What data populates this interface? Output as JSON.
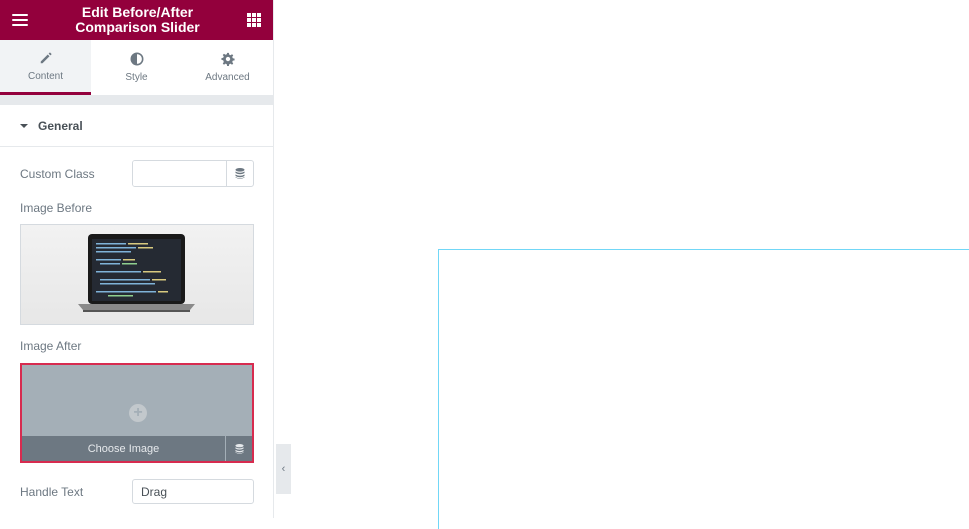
{
  "header": {
    "title_line1": "Edit Before/After",
    "title_line2": "Comparison Slider",
    "menu_icon": "hamburger-icon",
    "apps_icon": "grid-icon"
  },
  "tabs": [
    {
      "label": "Content",
      "icon": "pencil-icon",
      "active": true
    },
    {
      "label": "Style",
      "icon": "half-circle-icon",
      "active": false
    },
    {
      "label": "Advanced",
      "icon": "gear-icon",
      "active": false
    }
  ],
  "section": {
    "title": "General",
    "fields": {
      "custom_class": {
        "label": "Custom Class",
        "value": "",
        "placeholder": ""
      },
      "image_before": {
        "label": "Image Before"
      },
      "image_after": {
        "label": "Image After",
        "choose_label": "Choose Image"
      },
      "handle_text": {
        "label": "Handle Text",
        "value": "Drag"
      }
    }
  },
  "colors": {
    "brand": "#93003c",
    "highlight_border": "#d72b4f",
    "preview_outline": "#71d7f7"
  },
  "collapse_icon": "chevron-left-icon",
  "collapse_glyph": "‹"
}
